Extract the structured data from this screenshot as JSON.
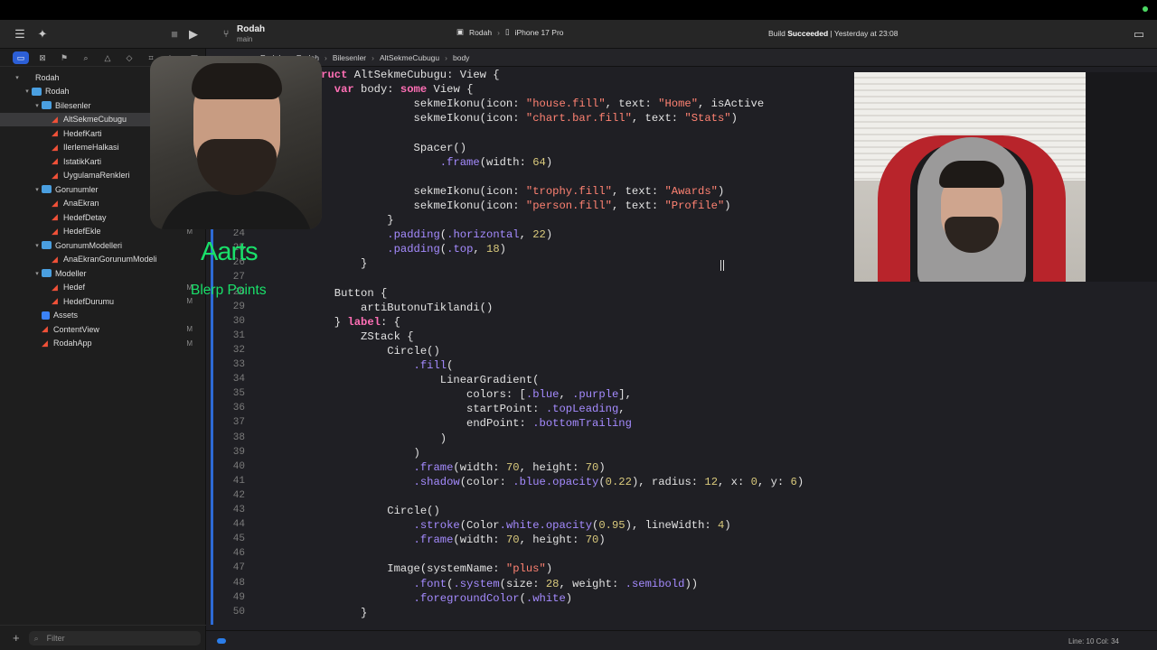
{
  "window": {
    "scheme": "Rodah",
    "branch": "main"
  },
  "toolbar": {
    "run_destination": {
      "app": "Rodah",
      "device": "iPhone 17 Pro"
    },
    "build_status_prefix": "Build ",
    "build_status_bold": "Succeeded",
    "build_status_suffix": " | Yesterday at 23:08"
  },
  "navigator": {
    "items": [
      {
        "label": "Rodah",
        "depth": 0,
        "kind": "project",
        "disclosure": "▾"
      },
      {
        "label": "Rodah",
        "depth": 1,
        "kind": "folder",
        "disclosure": "▾"
      },
      {
        "label": "Bilesenler",
        "depth": 2,
        "kind": "folder",
        "disclosure": "▾"
      },
      {
        "label": "AltSekmeCubugu",
        "depth": 3,
        "kind": "swift",
        "selected": true
      },
      {
        "label": "HedefKarti",
        "depth": 3,
        "kind": "swift"
      },
      {
        "label": "IlerlemeHalkasi",
        "depth": 3,
        "kind": "swift"
      },
      {
        "label": "IstatikKarti",
        "depth": 3,
        "kind": "swift"
      },
      {
        "label": "UygulamaRenkleri",
        "depth": 3,
        "kind": "swift"
      },
      {
        "label": "Gorunumler",
        "depth": 2,
        "kind": "folder",
        "disclosure": "▾"
      },
      {
        "label": "AnaEkran",
        "depth": 3,
        "kind": "swift"
      },
      {
        "label": "HedefDetay",
        "depth": 3,
        "kind": "swift"
      },
      {
        "label": "HedefEkle",
        "depth": 3,
        "kind": "swift",
        "badge": "M"
      },
      {
        "label": "GorunumModelleri",
        "depth": 2,
        "kind": "folder",
        "disclosure": "▾"
      },
      {
        "label": "AnaEkranGorunumModeli",
        "depth": 3,
        "kind": "swift"
      },
      {
        "label": "Modeller",
        "depth": 2,
        "kind": "folder",
        "disclosure": "▾"
      },
      {
        "label": "Hedef",
        "depth": 3,
        "kind": "swift",
        "badge": "M"
      },
      {
        "label": "HedefDurumu",
        "depth": 3,
        "kind": "swift",
        "badge": "M"
      },
      {
        "label": "Assets",
        "depth": 2,
        "kind": "assets"
      },
      {
        "label": "ContentView",
        "depth": 2,
        "kind": "swift",
        "badge": "M"
      },
      {
        "label": "RodahApp",
        "depth": 2,
        "kind": "swift",
        "badge": "M"
      }
    ],
    "filter_placeholder": "Filter"
  },
  "jumpbar": [
    "Rodah",
    "Rodah",
    "Bilesenler",
    "AltSekmeCubugu",
    "body"
  ],
  "editor": {
    "lines": [
      {
        "n": "",
        "code": "        struct AltSekmeCubugu: View {"
      },
      {
        "n": "",
        "code": "            var body: some View {"
      },
      {
        "n": "",
        "code": "                        sekmeIkonu(icon: \"house.fill\", text: \"Home\", isActive"
      },
      {
        "n": "",
        "code": "                        sekmeIkonu(icon: \"chart.bar.fill\", text: \"Stats\")"
      },
      {
        "n": "",
        "code": ""
      },
      {
        "n": "",
        "code": "                        Spacer()"
      },
      {
        "n": "",
        "code": "                            .frame(width: 64)"
      },
      {
        "n": "",
        "code": ""
      },
      {
        "n": "",
        "code": "                        sekmeIkonu(icon: \"trophy.fill\", text: \"Awards\")"
      },
      {
        "n": "",
        "code": "                        sekmeIkonu(icon: \"person.fill\", text: \"Profile\")"
      },
      {
        "n": "23",
        "code": "                    }"
      },
      {
        "n": "24",
        "code": "                    .padding(.horizontal, 22)"
      },
      {
        "n": "25",
        "code": "                    .padding(.top, 18)"
      },
      {
        "n": "26",
        "code": "                }"
      },
      {
        "n": "27",
        "code": ""
      },
      {
        "n": "28",
        "code": "            Button {"
      },
      {
        "n": "29",
        "code": "                artiButonuTiklandi()"
      },
      {
        "n": "30",
        "code": "            } label: {"
      },
      {
        "n": "31",
        "code": "                ZStack {"
      },
      {
        "n": "32",
        "code": "                    Circle()"
      },
      {
        "n": "33",
        "code": "                        .fill("
      },
      {
        "n": "34",
        "code": "                            LinearGradient("
      },
      {
        "n": "35",
        "code": "                                colors: [.blue, .purple],"
      },
      {
        "n": "36",
        "code": "                                startPoint: .topLeading,"
      },
      {
        "n": "37",
        "code": "                                endPoint: .bottomTrailing"
      },
      {
        "n": "38",
        "code": "                            )"
      },
      {
        "n": "39",
        "code": "                        )"
      },
      {
        "n": "40",
        "code": "                        .frame(width: 70, height: 70)"
      },
      {
        "n": "41",
        "code": "                        .shadow(color: .blue.opacity(0.22), radius: 12, x: 0, y: 6)"
      },
      {
        "n": "42",
        "code": ""
      },
      {
        "n": "43",
        "code": "                    Circle()"
      },
      {
        "n": "44",
        "code": "                        .stroke(Color.white.opacity(0.95), lineWidth: 4)"
      },
      {
        "n": "45",
        "code": "                        .frame(width: 70, height: 70)"
      },
      {
        "n": "46",
        "code": ""
      },
      {
        "n": "47",
        "code": "                    Image(systemName: \"plus\")"
      },
      {
        "n": "48",
        "code": "                        .font(.system(size: 28, weight: .semibold))"
      },
      {
        "n": "49",
        "code": "                        .foregroundColor(.white)"
      },
      {
        "n": "50",
        "code": "                }"
      }
    ]
  },
  "statusbar": {
    "position": "Line: 10  Col: 34"
  },
  "overlay": {
    "name": "Aarts",
    "points": "Blerp Points"
  },
  "colors": {
    "accent": "#2c5fd6",
    "overlay_text": "#19e06a",
    "keyword": "#ff6fb5",
    "string": "#ff8272",
    "number": "#d9c97c"
  }
}
